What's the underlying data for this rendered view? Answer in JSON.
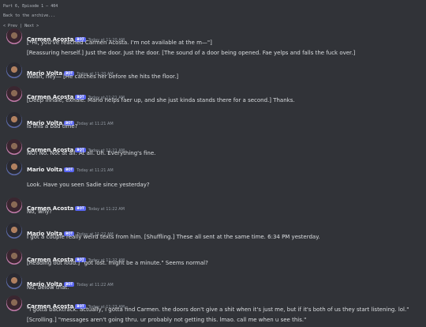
{
  "header": {
    "title": "Part 6, Episode 1 — 404",
    "back_link": "Back to the archive...",
    "nav": {
      "prev": "< Prev",
      "sep": "|",
      "next": "Next >"
    }
  },
  "bot_badge": "BOT",
  "messages": [
    {
      "author": "Carmen Acosta",
      "time": "Today at 11:20 AM",
      "lines": [
        "[*Hi, you've reached Carmen Acosta. I'm not available at the m—\"]",
        "[Reassuring herself.] Just the door. Just the door. [The sound of a door being opened. Fae yelps and falls the fuck over.]"
      ]
    },
    {
      "author": "Mario Volta",
      "time": "Today at 11:20 AM",
      "lines": [
        "Woah, hey— [He catches her before she hits the floor.]"
      ]
    },
    {
      "author": "Carmen Acosta",
      "time": "Today at 11:21 AM",
      "lines": [
        "[Deep inhale, exhale. Mario helps faer up, and she just kinda stands there for a second.] Thanks."
      ]
    },
    {
      "author": "Mario Volta",
      "time": "Today at 11:21 AM",
      "lines": [
        "Is this a bad time?"
      ]
    },
    {
      "author": "Carmen Acosta",
      "time": "Today at 11:21 AM",
      "lines": [
        "NO! No. Not at all. At all. Uh. Everything's fine."
      ]
    },
    {
      "author": "Mario Volta",
      "time": "Today at 11:21 AM",
      "lines": [
        "",
        "Look. Have you seen Sadie since yesterday?"
      ]
    },
    {
      "author": "Carmen Acosta",
      "time": "Today at 11:22 AM",
      "lines": [
        "No, why?"
      ]
    },
    {
      "author": "Mario Volta",
      "time": "Today at 11:22 AM",
      "lines": [
        "I got a couple really weird texts from him. [Shuffling.] These all sent at the same time. 6:34 PM yesterday."
      ]
    },
    {
      "author": "Carmen Acosta",
      "time": "Today at 11:22 AM",
      "lines": [
        "[Reading out loud.] \"got lost. might be a minute.\" Seems normal?"
      ]
    },
    {
      "author": "Mario Volta",
      "time": "Today at 11:22 AM",
      "lines": [
        "No, below that."
      ]
    },
    {
      "author": "Carmen Acosta",
      "time": "Today at 11:23 AM",
      "lines": [
        "\"i gotta backtrack. actually, i gotta find Carmen. the doors don't give a shit when it's just me, but if it's both of us they start listening. lol.\"",
        "[Scrolling.] \"messages aren't going thru. ur probably not getting this. lmao. call me when u see this.\""
      ]
    }
  ]
}
